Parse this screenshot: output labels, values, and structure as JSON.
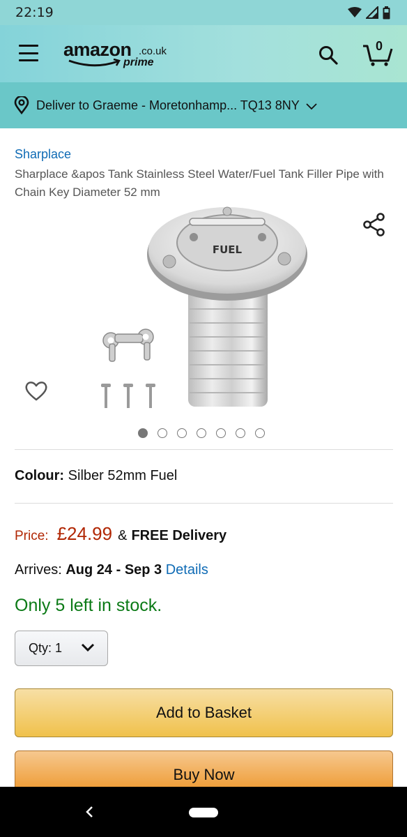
{
  "status_bar": {
    "time": "22:19"
  },
  "header": {
    "logo_word": "amazon",
    "logo_tld": ".co.uk",
    "logo_prime": "prime",
    "cart_count": "0"
  },
  "delivery": {
    "text": "Deliver to Graeme - Moretonhamp... TQ13 8NY"
  },
  "product": {
    "brand": "Sharplace",
    "title": "Sharplace &apos Tank Stainless Steel Water/Fuel Tank Filler Pipe with Chain Key Diameter 52 mm",
    "image_label": "FUEL",
    "image_count": 7,
    "image_active_index": 1
  },
  "colour": {
    "label": "Colour:",
    "value": "Silber 52mm Fuel"
  },
  "price": {
    "label": "Price:",
    "value": "£24.99",
    "amp": "&",
    "delivery": "FREE Delivery"
  },
  "arrival": {
    "label": "Arrives:",
    "dates": "Aug 24 - Sep 3",
    "details_link": "Details"
  },
  "stock": {
    "text": "Only 5 left in stock."
  },
  "quantity": {
    "label": "Qty:",
    "value": "1"
  },
  "actions": {
    "add_to_basket": "Add to Basket",
    "buy_now": "Buy Now"
  },
  "colors": {
    "header_teal": "#84d3d9",
    "deliver_bar": "#6ac7c8",
    "price_red": "#b12704",
    "stock_green": "#0b7a16",
    "link_blue": "#0f6bb5",
    "add_yellow": "#f0c14b",
    "buy_orange": "#ed9220"
  },
  "icons": [
    "wifi-icon",
    "signal-icon",
    "battery-icon",
    "menu-icon",
    "search-icon",
    "cart-icon",
    "location-pin-icon",
    "chevron-down-icon",
    "share-icon",
    "heart-icon",
    "back-icon",
    "home-pill-icon"
  ]
}
